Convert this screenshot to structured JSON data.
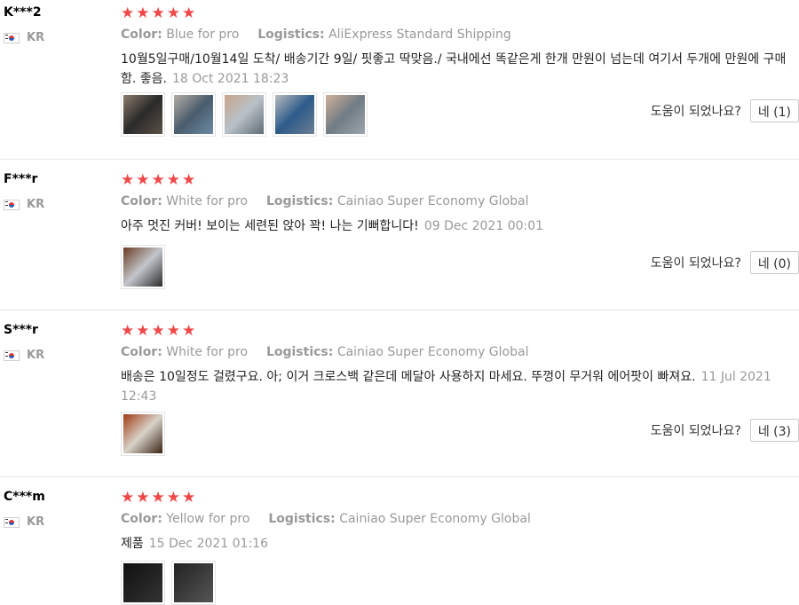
{
  "reviews": [
    {
      "user": "K***2",
      "country": "KR",
      "color_label": "Color:",
      "color_value": "Blue for pro",
      "logistics_label": "Logistics:",
      "logistics_value": "AliExpress Standard Shipping",
      "text": "10월5일구매/10월14일 도착/ 배송기간 9일/ 핏좋고 딱맞음./ 국내에선 똑같은게 한개 만원이 넘는데 여기서 두개에 만원에 구매함. 좋음.",
      "date": "18 Oct 2021 18:23",
      "helpful_label": "도움이 되었나요?",
      "helpful_button": "네 (1)"
    },
    {
      "user": "F***r",
      "country": "KR",
      "color_label": "Color:",
      "color_value": "White for pro",
      "logistics_label": "Logistics:",
      "logistics_value": "Cainiao Super Economy Global",
      "text": "아주 멋진 커버! 보이는 세련된 앉아 꽉! 나는 기뻐합니다!",
      "date": "09 Dec 2021 00:01",
      "helpful_label": "도움이 되었나요?",
      "helpful_button": "네 (0)"
    },
    {
      "user": "S***r",
      "country": "KR",
      "color_label": "Color:",
      "color_value": "White for pro",
      "logistics_label": "Logistics:",
      "logistics_value": "Cainiao Super Economy Global",
      "text": "배송은 10일정도 걸렸구요. 아; 이거 크로스백 같은데 메달아 사용하지 마세요. 뚜껑이 무거워 에어팟이 빠져요.",
      "date": "11 Jul 2021 12:43",
      "helpful_label": "도움이 되었나요?",
      "helpful_button": "네 (3)"
    },
    {
      "user": "C***m",
      "country": "KR",
      "color_label": "Color:",
      "color_value": "Yellow for pro",
      "logistics_label": "Logistics:",
      "logistics_value": "Cainiao Super Economy Global",
      "text": "제품",
      "date": "15 Dec 2021 01:16"
    }
  ],
  "rating_star": "★",
  "colors": {
    "star": "#f04848",
    "muted": "#999999"
  }
}
